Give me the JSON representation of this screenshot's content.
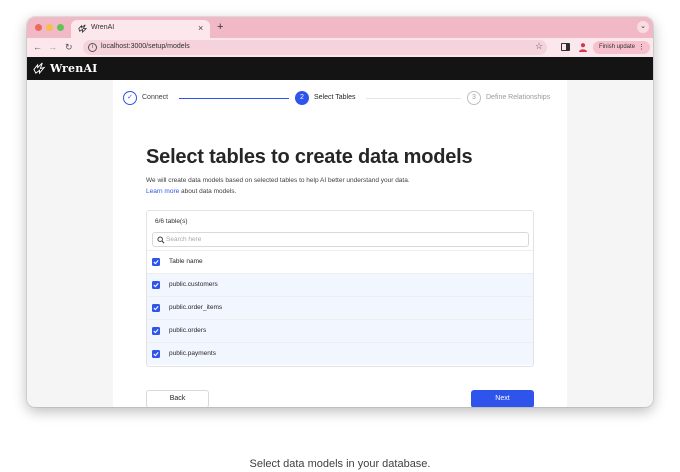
{
  "browser": {
    "tab_title": "WrenAI",
    "tab_close": "×",
    "new_tab": "+",
    "tab_menu_icon": "chevron-down",
    "url": "localhost:3000/setup/models",
    "update_label": "Finish update",
    "update_menu": "⋮"
  },
  "app": {
    "brand": "WrenAI"
  },
  "stepper": {
    "steps": [
      {
        "number": "✓",
        "label": "Connect",
        "state": "done"
      },
      {
        "number": "2",
        "label": "Select Tables",
        "state": "current"
      },
      {
        "number": "3",
        "label": "Define Relationships",
        "state": "pending"
      }
    ]
  },
  "page": {
    "title": "Select tables to create data models",
    "description": "We will create data models based on selected tables to help AI better understand your data.",
    "learn_more": "Learn more",
    "learn_more_suffix": " about data models."
  },
  "table": {
    "count_label": "6/6 table(s)",
    "search_placeholder": "Search here",
    "header": "Table name",
    "rows": [
      {
        "name": "public.customers",
        "checked": true
      },
      {
        "name": "public.order_items",
        "checked": true
      },
      {
        "name": "public.orders",
        "checked": true
      },
      {
        "name": "public.payments",
        "checked": true
      }
    ]
  },
  "buttons": {
    "back": "Back",
    "next": "Next"
  },
  "caption": "Select data models in your database.",
  "colors": {
    "accent": "#2f54eb",
    "tabbar": "#f1b9c6",
    "header_bg": "#141414"
  }
}
